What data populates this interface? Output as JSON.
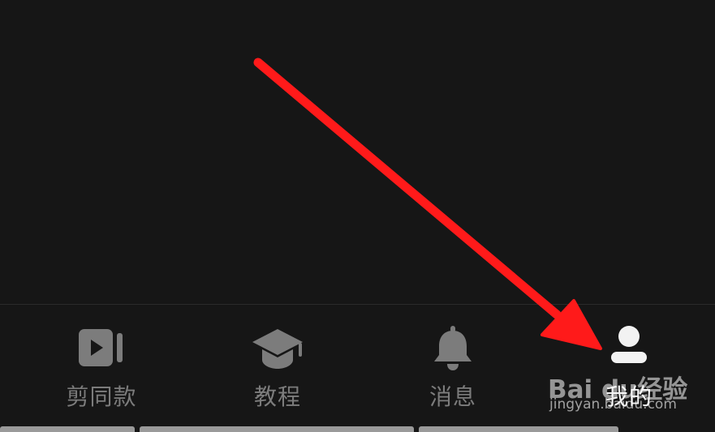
{
  "tabbar": {
    "items": [
      {
        "label": "剪同款",
        "icon": "video-template-icon",
        "active": false
      },
      {
        "label": "教程",
        "icon": "graduation-cap-icon",
        "active": false
      },
      {
        "label": "消息",
        "icon": "bell-icon",
        "active": false
      },
      {
        "label": "我的",
        "icon": "profile-icon",
        "active": true
      }
    ]
  },
  "colors": {
    "background": "#161616",
    "inactive": "#7c7c7c",
    "active": "#f2f2f2",
    "annotation_arrow": "#ff1a1a"
  },
  "watermark": {
    "brand": "Bai du经验",
    "url": "jingyan.baidu.com"
  }
}
